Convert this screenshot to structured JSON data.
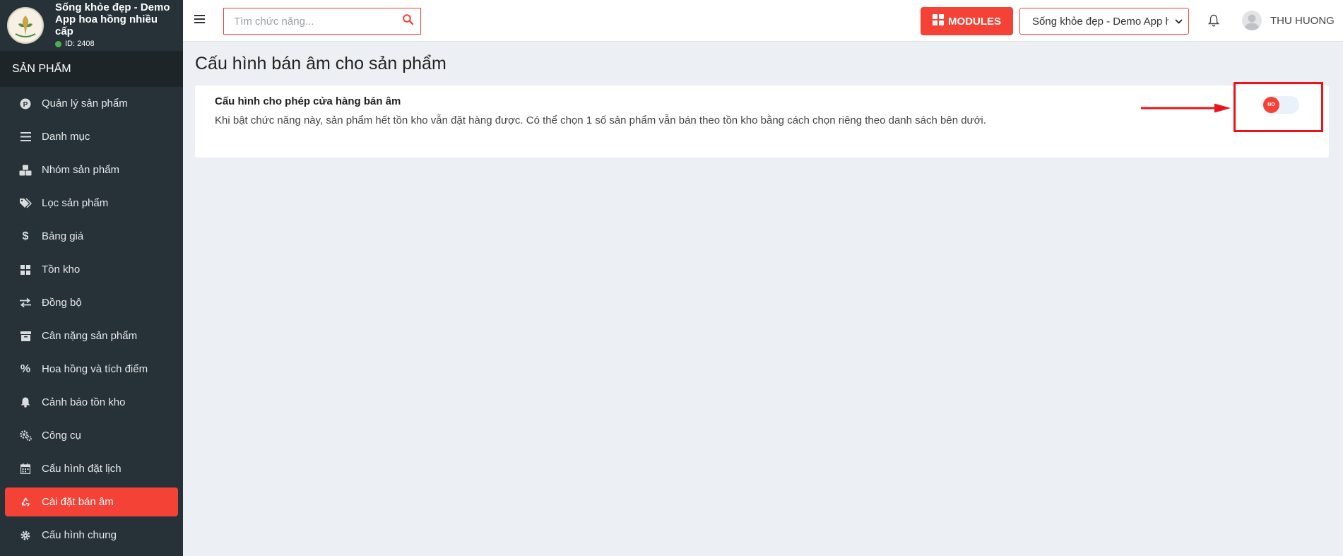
{
  "brand": {
    "name": "Sống khỏe đẹp - Demo App hoa hồng nhiều cấp",
    "id_label": "ID: 2408"
  },
  "sidebar": {
    "section_title": "SẢN PHẨM",
    "items": [
      {
        "label": "Quản lý sản phẩm",
        "icon": "product-circle-icon",
        "active": false
      },
      {
        "label": "Danh mục",
        "icon": "list-icon",
        "active": false
      },
      {
        "label": "Nhóm sản phẩm",
        "icon": "cubes-icon",
        "active": false
      },
      {
        "label": "Lọc sản phẩm",
        "icon": "tags-icon",
        "active": false
      },
      {
        "label": "Bảng giá",
        "icon": "dollar-icon",
        "active": false
      },
      {
        "label": "Tồn kho",
        "icon": "grid-icon",
        "active": false
      },
      {
        "label": "Đồng bộ",
        "icon": "exchange-icon",
        "active": false
      },
      {
        "label": "Cân nặng sản phẩm",
        "icon": "archive-icon",
        "active": false
      },
      {
        "label": "Hoa hồng và tích điểm",
        "icon": "percent-icon",
        "active": false
      },
      {
        "label": "Cảnh báo tồn kho",
        "icon": "bell-icon",
        "active": false
      },
      {
        "label": "Công cụ",
        "icon": "gears-icon",
        "active": false
      },
      {
        "label": "Cấu hình đặt lịch",
        "icon": "calendar-icon",
        "active": false
      },
      {
        "label": "Cài đặt bán âm",
        "icon": "recycle-icon",
        "active": true
      },
      {
        "label": "Cấu hình chung",
        "icon": "gear-icon",
        "active": false
      }
    ]
  },
  "header": {
    "search_placeholder": "Tìm chức năng...",
    "modules_label": "MODULES",
    "app_select_value": "Sống khỏe đẹp - Demo App h",
    "user_name": "THU HUONG"
  },
  "main": {
    "page_title": "Cấu hình bán âm cho sản phẩm",
    "setting": {
      "title": "Cấu hình cho phép cửa hàng bán âm",
      "description": "Khi bật chức năng này, sản phẩm hết tồn kho vẫn đặt hàng được. Có thể chọn 1 số sản phẩm vẫn bán theo tồn kho bằng cách chọn riêng theo danh sách bên dưới.",
      "toggle_label": "NO",
      "toggle_on": false
    }
  },
  "colors": {
    "accent": "#f44336",
    "sidebar_bg": "#263238",
    "annotation_red": "#e8141e"
  }
}
